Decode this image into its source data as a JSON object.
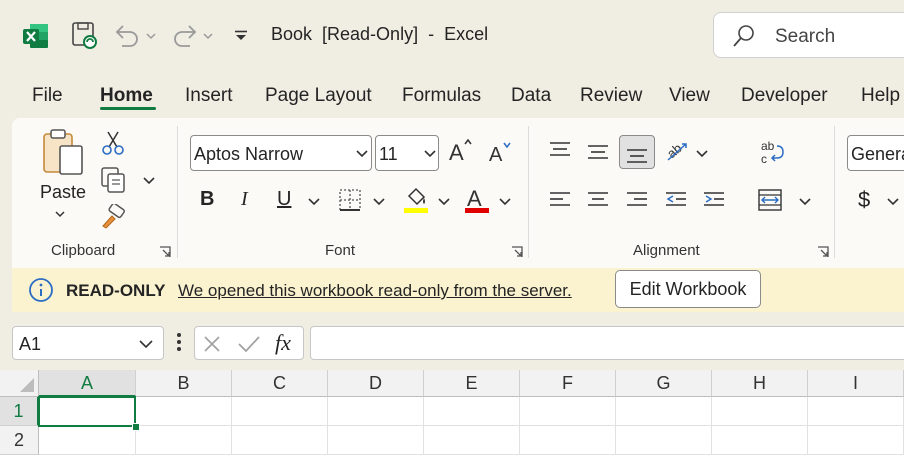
{
  "window": {
    "title": "Book  [Read-Only]  -  Excel",
    "search_placeholder": "Search"
  },
  "tabs": [
    {
      "label": "File"
    },
    {
      "label": "Home",
      "active": true
    },
    {
      "label": "Insert"
    },
    {
      "label": "Page Layout"
    },
    {
      "label": "Formulas"
    },
    {
      "label": "Data"
    },
    {
      "label": "Review"
    },
    {
      "label": "View"
    },
    {
      "label": "Developer"
    },
    {
      "label": "Help"
    }
  ],
  "ribbon": {
    "clipboard": {
      "paste_label": "Paste",
      "group_label": "Clipboard"
    },
    "font": {
      "font_name": "Aptos Narrow",
      "font_size": "11",
      "group_label": "Font",
      "bold": "B",
      "italic": "I",
      "underline": "U"
    },
    "alignment": {
      "group_label": "Alignment"
    },
    "number": {
      "format": "General",
      "currency_symbol": "$"
    }
  },
  "infobar": {
    "badge": "READ-ONLY",
    "message": "We opened this workbook read-only from the server.",
    "button": "Edit Workbook"
  },
  "formula_bar": {
    "name_box": "A1",
    "fx": "fx",
    "formula": ""
  },
  "grid": {
    "columns": [
      "A",
      "B",
      "C",
      "D",
      "E",
      "F",
      "G",
      "H",
      "I"
    ],
    "rows": [
      "1",
      "2"
    ],
    "selected_cell": "A1"
  },
  "colors": {
    "accent": "#107c41",
    "infobar_bg": "#fbf3d0",
    "chrome_bg": "#f0eee3",
    "ribbon_bg": "#fbfaf7"
  }
}
